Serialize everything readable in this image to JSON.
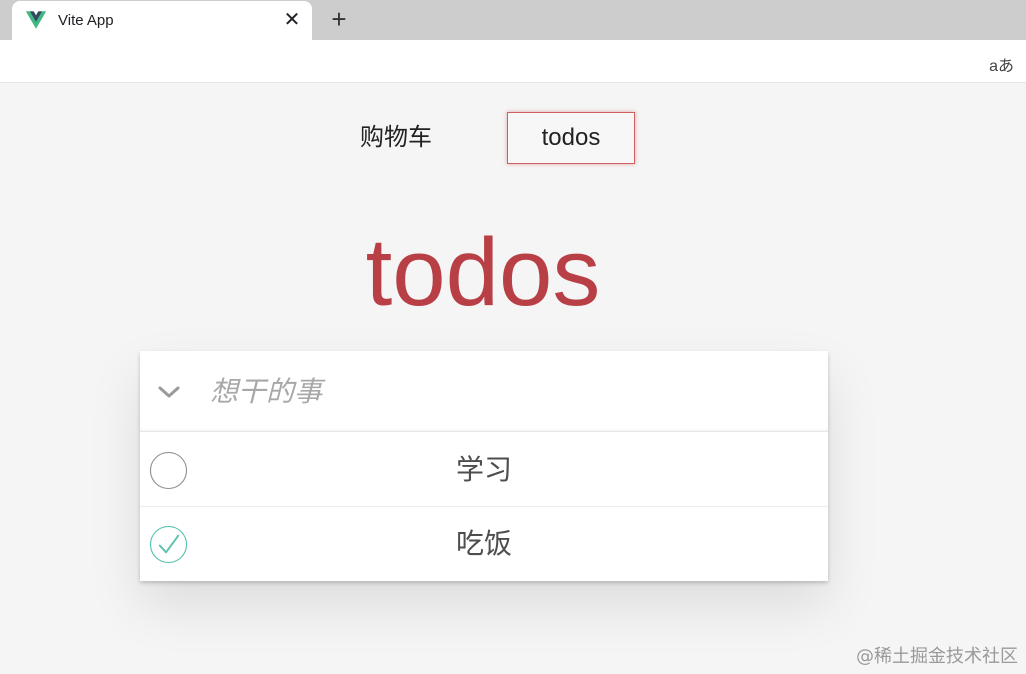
{
  "browser": {
    "tab_title": "Vite App",
    "tab_close": "✕",
    "new_tab": "+",
    "translate": "aあ",
    "favicon_colors": {
      "outer": "#41b883",
      "inner": "#34495e"
    }
  },
  "nav": {
    "items": [
      {
        "label": "购物车",
        "active": false
      },
      {
        "label": "todos",
        "active": true
      }
    ]
  },
  "app": {
    "title": "todos",
    "title_color": "#b83f45",
    "new_todo": {
      "value": "",
      "placeholder": "想干的事"
    },
    "toggle_all_icon": "chevron-down-icon",
    "todos": [
      {
        "label": "学习",
        "completed": false
      },
      {
        "label": "吃饭",
        "completed": true
      }
    ],
    "check_color": "#5dc2af"
  },
  "watermark": "@稀土掘金技术社区"
}
